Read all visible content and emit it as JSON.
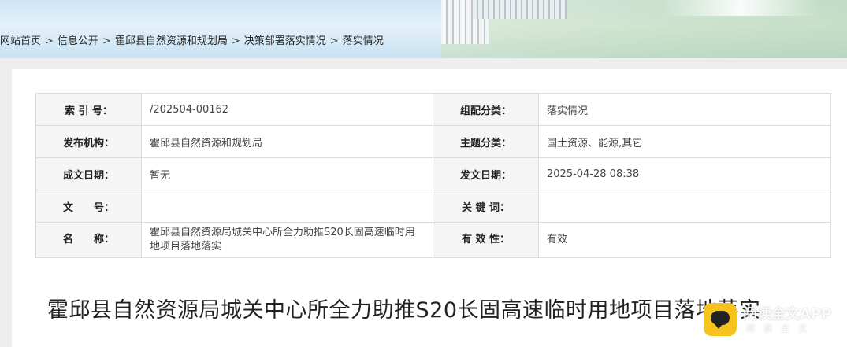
{
  "breadcrumb": {
    "items": [
      "网站首页",
      "信息公开",
      "霍邱县自然资源和规划局",
      "决策部署落实情况",
      "落实情况"
    ],
    "separator": ">"
  },
  "meta": {
    "rows": [
      {
        "label1": "索 引 号：",
        "value1": "/202504-00162",
        "label2": "组配分类：",
        "value2": "落实情况"
      },
      {
        "label1": "发布机构：",
        "value1": "霍邱县自然资源和规划局",
        "label2": "主题分类：",
        "value2": "国土资源、能源,其它"
      },
      {
        "label1": "成文日期：",
        "value1": "暂无",
        "label2": "发文日期：",
        "value2": "2025-04-28 08:38"
      },
      {
        "label1": "文　　号：",
        "value1": "",
        "label2": "关 键 词：",
        "value2": ""
      },
      {
        "label1": "名　　称：",
        "value1": "霍邱县自然资源局城关中心所全力助推S20长固高速临时用地项目落地落实",
        "label2": "有 效 性：",
        "value2": "有效"
      }
    ]
  },
  "document": {
    "title": "霍邱县自然资源局城关中心所全力助推S20长固高速临时用地项目落地落实"
  },
  "watermark": {
    "name": "阅读全文APP",
    "sub": "阅读全文"
  },
  "colors": {
    "label_bg": "#f5f5f5",
    "border": "#dcdcdc",
    "page_bg": "#eeeeee",
    "badge": "#f6c21c"
  }
}
